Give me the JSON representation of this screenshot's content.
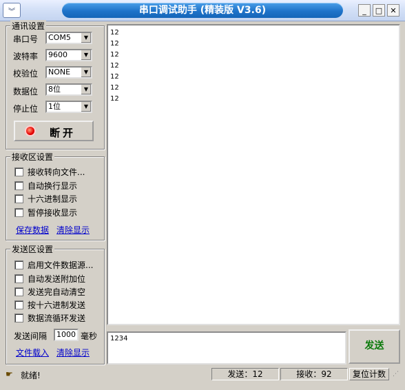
{
  "window": {
    "title": "串口调试助手 (精装版 V3.6)",
    "minimize_icon": "minimize-icon",
    "maximize_icon": "maximize-icon",
    "close_icon": "close-icon"
  },
  "comm_settings": {
    "title": "通讯设置",
    "fields": [
      {
        "label": "串口号",
        "value": "COM5"
      },
      {
        "label": "波特率",
        "value": "9600"
      },
      {
        "label": "校验位",
        "value": "NONE"
      },
      {
        "label": "数据位",
        "value": "8位"
      },
      {
        "label": "停止位",
        "value": "1位"
      }
    ],
    "connect_button": "断开",
    "status_led_color": "#e60000"
  },
  "receive_settings": {
    "title": "接收区设置",
    "options": [
      "接收转向文件...",
      "自动换行显示",
      "十六进制显示",
      "暂停接收显示"
    ],
    "save_link": "保存数据",
    "clear_link": "清除显示"
  },
  "send_settings": {
    "title": "发送区设置",
    "options": [
      "启用文件数据源...",
      "自动发送附加位",
      "发送完自动清空",
      "按十六进制发送",
      "数据流循环发送"
    ],
    "interval_label": "发送间隔",
    "interval_value": "1000",
    "interval_unit": "毫秒",
    "load_file_link": "文件载入",
    "clear_link": "清除显示"
  },
  "receive_area": {
    "lines": [
      "12",
      "12",
      "12",
      "12",
      "12",
      "12",
      "12"
    ]
  },
  "send_area": {
    "text": "1234",
    "send_button": "发送",
    "send_button_color": "#0a7a0a"
  },
  "status_bar": {
    "ready_text": "就绪!",
    "sent": "发送：12",
    "received": "接收：92",
    "reset_button": "复位计数"
  }
}
